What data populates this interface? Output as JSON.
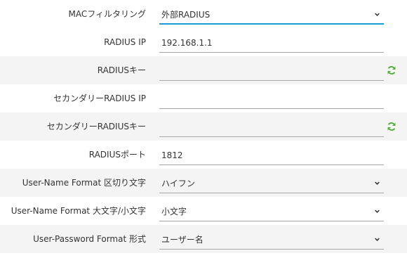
{
  "rows": [
    {
      "label": "MACフィルタリング",
      "value": "外部RADIUS",
      "kind": "select"
    },
    {
      "label": "RADIUS IP",
      "value": "192.168.1.1",
      "kind": "text"
    },
    {
      "label": "RADIUSキー",
      "value": "",
      "kind": "password"
    },
    {
      "label": "セカンダリーRADIUS IP",
      "value": "",
      "kind": "text"
    },
    {
      "label": "セカンダリーRADIUSキー",
      "value": "",
      "kind": "password"
    },
    {
      "label": "RADIUSポート",
      "value": "1812",
      "kind": "text"
    },
    {
      "label": "User-Name Format 区切り文字",
      "value": "ハイフン",
      "kind": "select"
    },
    {
      "label": "User-Name Format 大文字/小文字",
      "value": "小文字",
      "kind": "select"
    },
    {
      "label": "User-Password Format 形式",
      "value": "ユーザー名",
      "kind": "select"
    }
  ],
  "icons": {
    "select_arrow": "chevron-down-icon",
    "key_refresh": "refresh-icon"
  },
  "colors": {
    "accent": "#1a9ad6",
    "refresh_icon": "#5aae3c"
  }
}
